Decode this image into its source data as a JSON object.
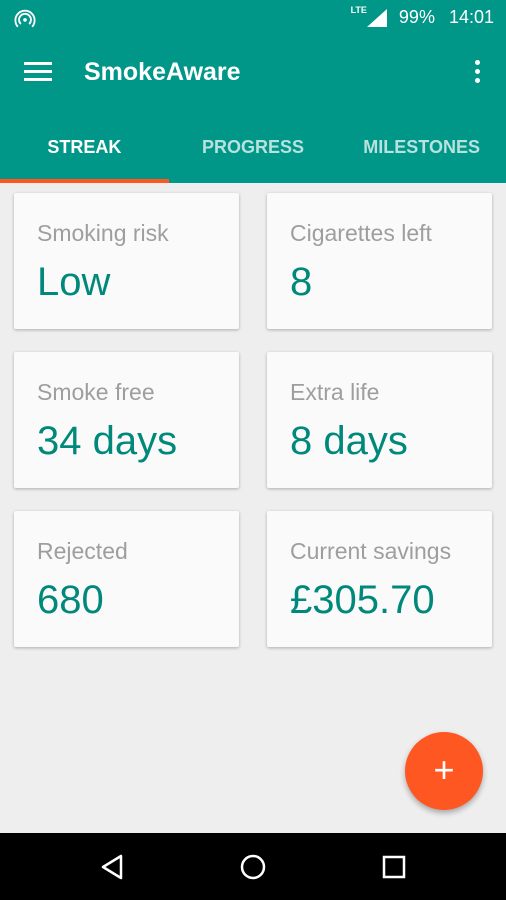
{
  "status_bar": {
    "network": "LTE",
    "battery": "99%",
    "time": "14:01"
  },
  "app": {
    "title": "SmokeAware",
    "menu_icon": "hamburger-menu-icon",
    "more_icon": "more-vert-icon"
  },
  "tabs": [
    {
      "label": "STREAK",
      "active": true
    },
    {
      "label": "PROGRESS",
      "active": false
    },
    {
      "label": "MILESTONES",
      "active": false
    }
  ],
  "cards": [
    {
      "label": "Smoking risk",
      "value": "Low"
    },
    {
      "label": "Cigarettes left",
      "value": "8"
    },
    {
      "label": "Smoke free",
      "value": "34 days"
    },
    {
      "label": "Extra life",
      "value": "8 days"
    },
    {
      "label": "Rejected",
      "value": "680"
    },
    {
      "label": "Current savings",
      "value": "£305.70"
    }
  ],
  "fab": {
    "label": "+"
  },
  "colors": {
    "primary": "#009688",
    "accent": "#ff5722",
    "value_text": "#00897b",
    "label_text": "#9e9e9e"
  }
}
